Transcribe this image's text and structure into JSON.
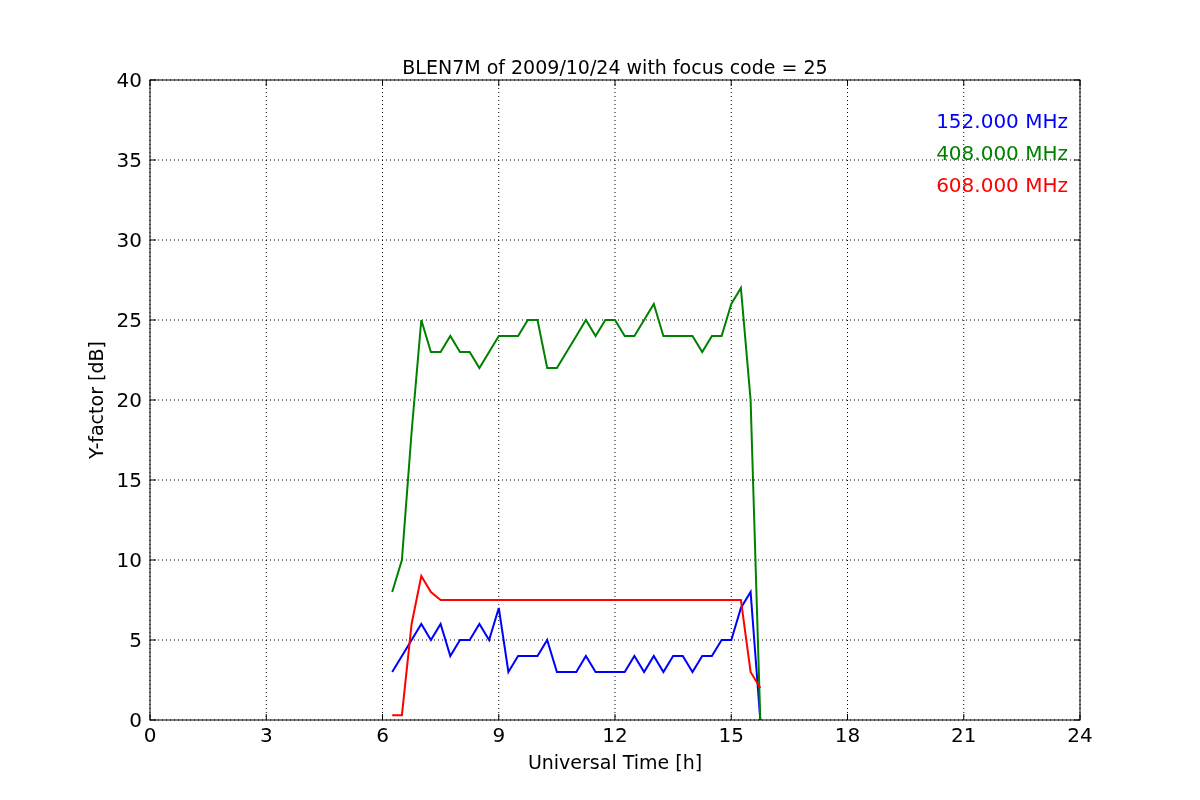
{
  "chart_data": {
    "type": "line",
    "title": "BLEN7M of 2009/10/24 with focus code = 25",
    "xlabel": "Universal Time [h]",
    "ylabel": "Y-factor [dB]",
    "x": [
      6.25,
      6.5,
      6.75,
      7,
      7.25,
      7.5,
      7.75,
      8,
      8.25,
      8.5,
      8.75,
      9,
      9.25,
      9.5,
      9.75,
      10,
      10.25,
      10.5,
      10.75,
      11,
      11.25,
      11.5,
      11.75,
      12,
      12.25,
      12.5,
      12.75,
      13,
      13.25,
      13.5,
      13.75,
      14,
      14.25,
      14.5,
      14.75,
      15,
      15.25,
      15.5,
      15.75
    ],
    "series": [
      {
        "name": "152.000 MHz",
        "color": "#0000ff",
        "values": [
          3,
          4,
          5,
          6,
          5,
          6,
          4,
          5,
          5,
          6,
          5,
          7,
          3,
          4,
          4,
          4,
          5,
          3,
          3,
          3,
          4,
          3,
          3,
          3,
          3,
          4,
          3,
          4,
          3,
          4,
          4,
          3,
          4,
          4,
          5,
          5,
          7,
          8,
          0
        ]
      },
      {
        "name": "408.000 MHz",
        "color": "#008000",
        "values": [
          8,
          10,
          18,
          25,
          23,
          23,
          24,
          23,
          23,
          22,
          23,
          24,
          24,
          24,
          25,
          25,
          22,
          22,
          23,
          24,
          25,
          24,
          25,
          25,
          24,
          24,
          25,
          26,
          24,
          24,
          24,
          24,
          23,
          24,
          24,
          26,
          27,
          20,
          0
        ]
      },
      {
        "name": "608.000 MHz",
        "color": "#ff0000",
        "values": [
          0.3,
          0.3,
          6,
          9,
          8,
          7.5,
          7.5,
          7.5,
          7.5,
          7.5,
          7.5,
          7.5,
          7.5,
          7.5,
          7.5,
          7.5,
          7.5,
          7.5,
          7.5,
          7.5,
          7.5,
          7.5,
          7.5,
          7.5,
          7.5,
          7.5,
          7.5,
          7.5,
          7.5,
          7.5,
          7.5,
          7.5,
          7.5,
          7.5,
          7.5,
          7.5,
          7.5,
          3,
          2
        ]
      }
    ],
    "xlim": [
      0,
      24
    ],
    "ylim": [
      0,
      40
    ],
    "xticks": [
      0,
      3,
      6,
      9,
      12,
      15,
      18,
      21,
      24
    ],
    "yticks": [
      0,
      5,
      10,
      15,
      20,
      25,
      30,
      35,
      40
    ],
    "grid": true
  }
}
